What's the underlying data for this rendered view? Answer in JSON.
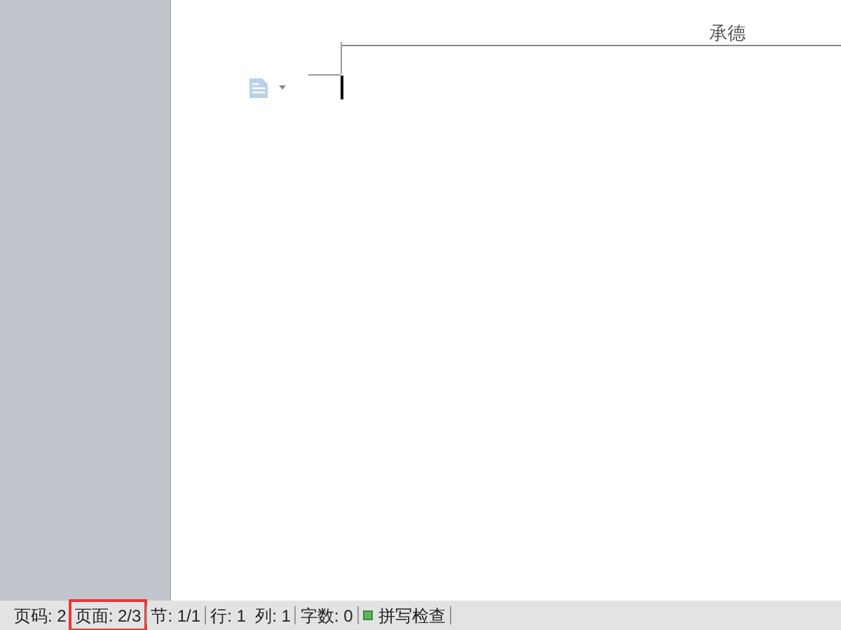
{
  "document": {
    "header_text": "承德"
  },
  "status_bar": {
    "items": [
      {
        "kind": "text",
        "label": "页码: 2",
        "highlighted": false
      },
      {
        "kind": "text",
        "label": "页面: 2/3",
        "highlighted": true
      },
      {
        "kind": "text",
        "label": "节: 1/1",
        "highlighted": false
      },
      {
        "kind": "text",
        "label": "行: 1  列: 1",
        "highlighted": false
      },
      {
        "kind": "text",
        "label": "字数: 0",
        "highlighted": false
      },
      {
        "kind": "spellcheck",
        "label": "拼写检查",
        "highlighted": false
      }
    ]
  }
}
